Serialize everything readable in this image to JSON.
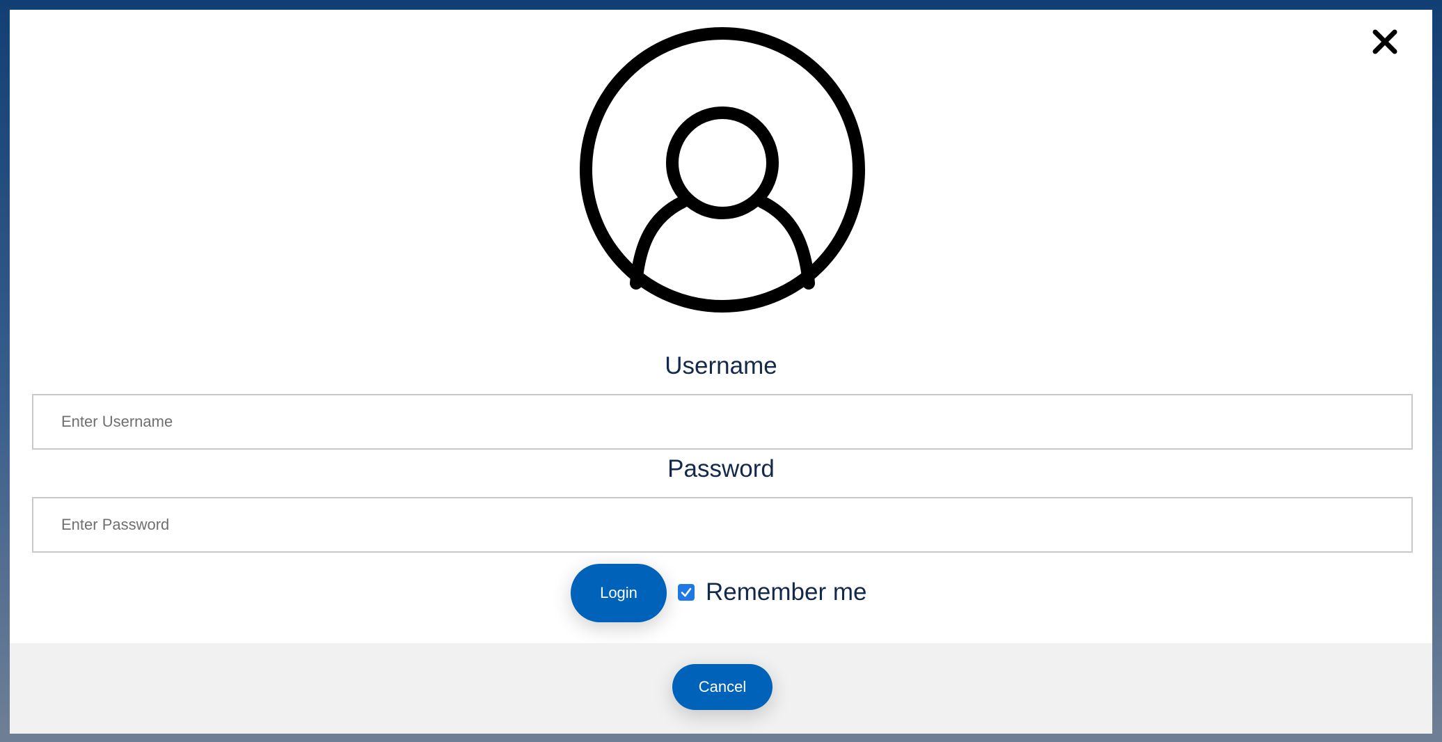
{
  "modal": {
    "close_icon": "close-icon",
    "avatar_icon": "user-avatar-icon",
    "username_label": "Username",
    "username_placeholder": "Enter Username",
    "username_value": "",
    "password_label": "Password",
    "password_placeholder": "Enter Password",
    "password_value": "",
    "login_label": "Login",
    "remember_label": "Remember me",
    "remember_checked": true,
    "cancel_label": "Cancel"
  },
  "colors": {
    "accent": "#0062b8",
    "label_text": "#13294b",
    "checkbox": "#1e79e6",
    "footer_bg": "#f1f1f1"
  }
}
